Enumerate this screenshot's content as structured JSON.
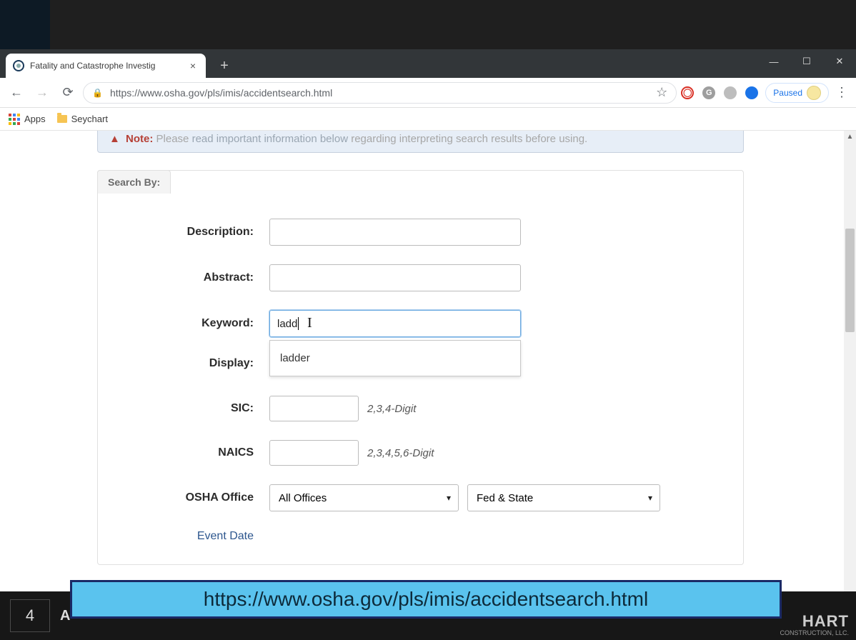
{
  "browser": {
    "tab_title": "Fatality and Catastrophe Investig",
    "url_display": "https://www.osha.gov/pls/imis/accidentsearch.html",
    "paused_label": "Paused",
    "bookmarks": {
      "apps": "Apps",
      "item1": "Seychart"
    }
  },
  "note": {
    "label": "Note:",
    "pre": "Please ",
    "link": "read important information below",
    "post": " regarding interpreting search results before using."
  },
  "form": {
    "search_by": "Search By:",
    "description_label": "Description:",
    "description_value": "",
    "abstract_label": "Abstract:",
    "abstract_value": "",
    "keyword_label": "Keyword:",
    "keyword_value": "ladd",
    "autocomplete_option": "ladder",
    "display_label": "Display:",
    "sic_label": "SIC:",
    "sic_hint": "2,3,4-Digit",
    "naics_label": "NAICS",
    "naics_hint": "2,3,4,5,6-Digit",
    "office_label": "OSHA Office",
    "office_select": "All Offices",
    "jurisdiction_select": "Fed & State",
    "event_date_label": "Event Date"
  },
  "banner_url": "https://www.osha.gov/pls/imis/accidentsearch.html",
  "footer": {
    "slide_number": "4",
    "slide_title_fragment": "A",
    "logo_line1": "HART",
    "logo_line2": "CONSTRUCTION, LLC."
  }
}
